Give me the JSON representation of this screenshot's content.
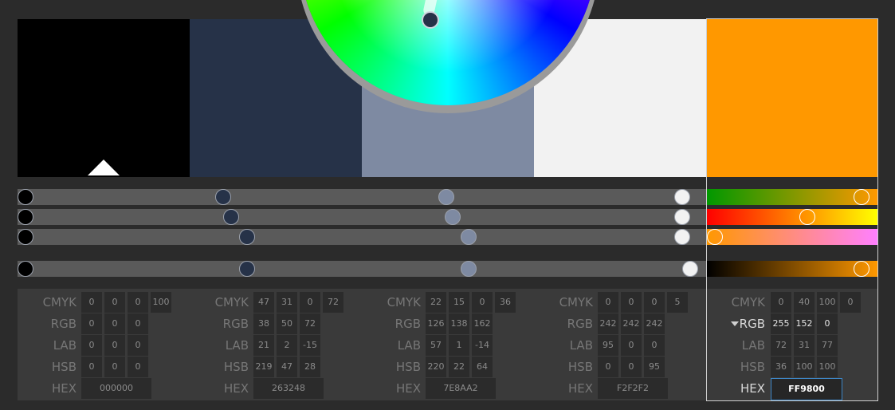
{
  "swatches": [
    {
      "color": "#000000"
    },
    {
      "color": "#263248"
    },
    {
      "color": "#7E8AA2"
    },
    {
      "color": "#F2F2F2"
    },
    {
      "color": "#FF9800"
    }
  ],
  "base_marker_icon": "triangle-up-icon",
  "sliders": {
    "ch1": [
      0.0,
      0.294,
      0.625,
      0.976
    ],
    "ch2": [
      0.0,
      0.306,
      0.635,
      0.976
    ],
    "ch3": [
      0.0,
      0.329,
      0.659,
      0.976
    ],
    "ch4": [
      0.0,
      0.329,
      0.659,
      0.988
    ],
    "active_ch1": 0.95,
    "active_ch2": 0.6,
    "active_ch3": 0.0,
    "active_ch4": 0.95
  },
  "labels": {
    "cmyk": "CMYK",
    "rgb": "RGB",
    "lab": "LAB",
    "hsb": "HSB",
    "hex": "HEX"
  },
  "colors": [
    {
      "cmyk": [
        "0",
        "0",
        "0",
        "100"
      ],
      "rgb": [
        "0",
        "0",
        "0"
      ],
      "lab": [
        "0",
        "0",
        "0"
      ],
      "hsb": [
        "0",
        "0",
        "0"
      ],
      "hex": "000000"
    },
    {
      "cmyk": [
        "47",
        "31",
        "0",
        "72"
      ],
      "rgb": [
        "38",
        "50",
        "72"
      ],
      "lab": [
        "21",
        "2",
        "-15"
      ],
      "hsb": [
        "219",
        "47",
        "28"
      ],
      "hex": "263248"
    },
    {
      "cmyk": [
        "22",
        "15",
        "0",
        "36"
      ],
      "rgb": [
        "126",
        "138",
        "162"
      ],
      "lab": [
        "57",
        "1",
        "-14"
      ],
      "hsb": [
        "220",
        "22",
        "64"
      ],
      "hex": "7E8AA2"
    },
    {
      "cmyk": [
        "0",
        "0",
        "0",
        "5"
      ],
      "rgb": [
        "242",
        "242",
        "242"
      ],
      "lab": [
        "95",
        "0",
        "0"
      ],
      "hsb": [
        "0",
        "0",
        "95"
      ],
      "hex": "F2F2F2"
    },
    {
      "cmyk": [
        "0",
        "40",
        "100",
        "0"
      ],
      "rgb": [
        "255",
        "152",
        "0"
      ],
      "lab": [
        "72",
        "31",
        "77"
      ],
      "hsb": [
        "36",
        "100",
        "100"
      ],
      "hex": "FF9800"
    }
  ],
  "active_mode": "RGB",
  "accent": "#3d86c6"
}
